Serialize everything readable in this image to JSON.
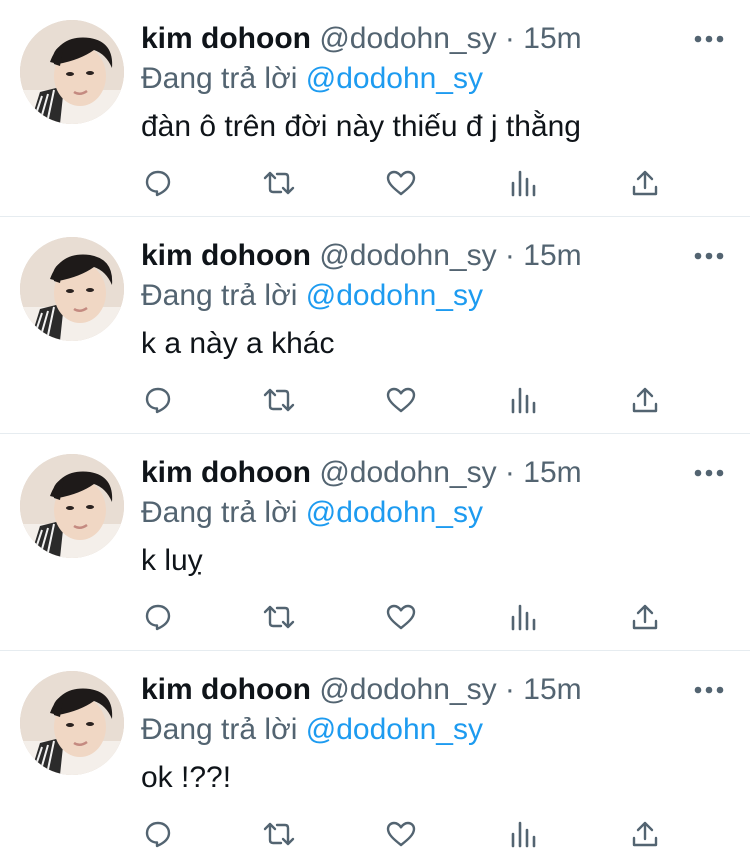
{
  "tweets": [
    {
      "display_name": "kim dohoon",
      "handle": "@dodohn_sy",
      "separator": "·",
      "time": "15m",
      "reply_prefix": "Đang trả lời",
      "reply_to": "@dodohn_sy",
      "text": "đàn ô trên đời này thiếu đ j thằng"
    },
    {
      "display_name": "kim dohoon",
      "handle": "@dodohn_sy",
      "separator": "·",
      "time": "15m",
      "reply_prefix": "Đang trả lời",
      "reply_to": "@dodohn_sy",
      "text": "k a này a khác"
    },
    {
      "display_name": "kim dohoon",
      "handle": "@dodohn_sy",
      "separator": "·",
      "time": "15m",
      "reply_prefix": "Đang trả lời",
      "reply_to": "@dodohn_sy",
      "text": "k luỵ"
    },
    {
      "display_name": "kim dohoon",
      "handle": "@dodohn_sy",
      "separator": "·",
      "time": "15m",
      "reply_prefix": "Đang trả lời",
      "reply_to": "@dodohn_sy",
      "text": "ok !??!"
    }
  ],
  "icons": {
    "more": "more-horizontal-icon",
    "reply": "reply-bubble-icon",
    "retweet": "retweet-icon",
    "like": "heart-icon",
    "stats": "stats-bar-chart-icon",
    "share": "share-upload-icon"
  },
  "colors": {
    "text_primary": "#0f1419",
    "text_secondary": "#536471",
    "link": "#1d9bf0",
    "divider": "#e6ecf0",
    "icon": "#536471"
  }
}
